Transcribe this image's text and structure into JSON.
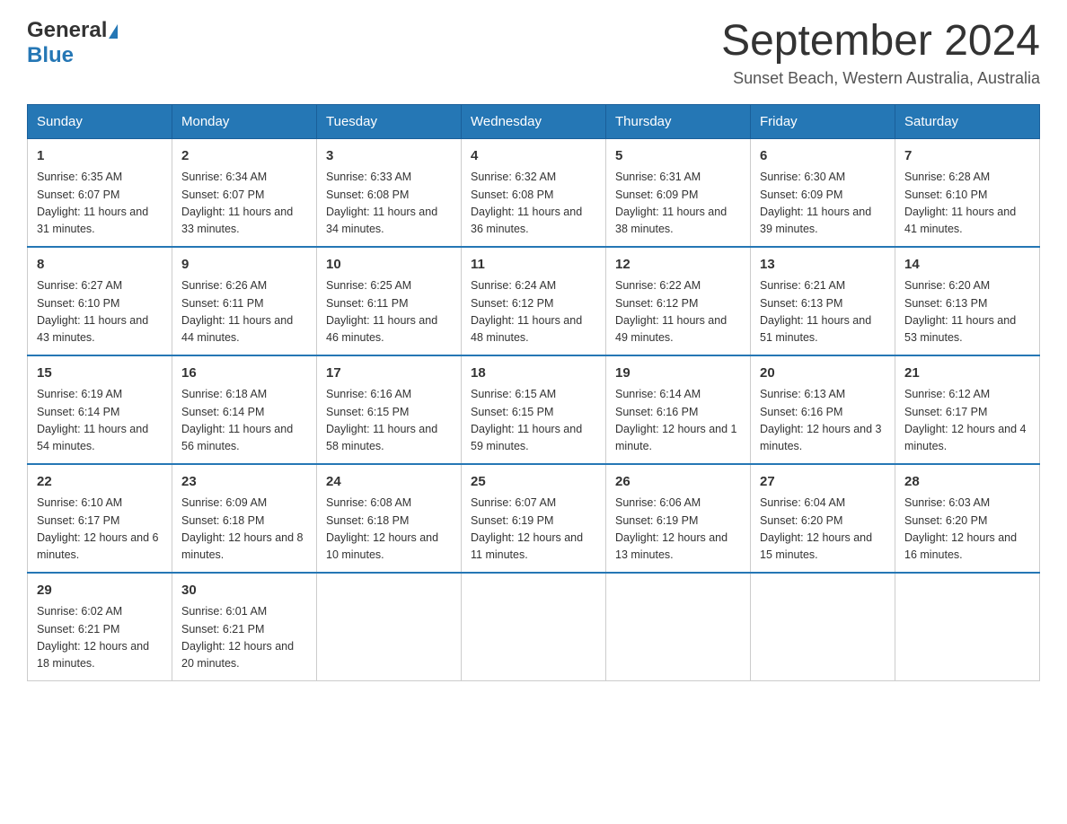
{
  "header": {
    "logo_general": "General",
    "logo_blue": "Blue",
    "month_year": "September 2024",
    "location": "Sunset Beach, Western Australia, Australia"
  },
  "days_of_week": [
    "Sunday",
    "Monday",
    "Tuesday",
    "Wednesday",
    "Thursday",
    "Friday",
    "Saturday"
  ],
  "weeks": [
    [
      {
        "day": "1",
        "sunrise": "6:35 AM",
        "sunset": "6:07 PM",
        "daylight": "11 hours and 31 minutes."
      },
      {
        "day": "2",
        "sunrise": "6:34 AM",
        "sunset": "6:07 PM",
        "daylight": "11 hours and 33 minutes."
      },
      {
        "day": "3",
        "sunrise": "6:33 AM",
        "sunset": "6:08 PM",
        "daylight": "11 hours and 34 minutes."
      },
      {
        "day": "4",
        "sunrise": "6:32 AM",
        "sunset": "6:08 PM",
        "daylight": "11 hours and 36 minutes."
      },
      {
        "day": "5",
        "sunrise": "6:31 AM",
        "sunset": "6:09 PM",
        "daylight": "11 hours and 38 minutes."
      },
      {
        "day": "6",
        "sunrise": "6:30 AM",
        "sunset": "6:09 PM",
        "daylight": "11 hours and 39 minutes."
      },
      {
        "day": "7",
        "sunrise": "6:28 AM",
        "sunset": "6:10 PM",
        "daylight": "11 hours and 41 minutes."
      }
    ],
    [
      {
        "day": "8",
        "sunrise": "6:27 AM",
        "sunset": "6:10 PM",
        "daylight": "11 hours and 43 minutes."
      },
      {
        "day": "9",
        "sunrise": "6:26 AM",
        "sunset": "6:11 PM",
        "daylight": "11 hours and 44 minutes."
      },
      {
        "day": "10",
        "sunrise": "6:25 AM",
        "sunset": "6:11 PM",
        "daylight": "11 hours and 46 minutes."
      },
      {
        "day": "11",
        "sunrise": "6:24 AM",
        "sunset": "6:12 PM",
        "daylight": "11 hours and 48 minutes."
      },
      {
        "day": "12",
        "sunrise": "6:22 AM",
        "sunset": "6:12 PM",
        "daylight": "11 hours and 49 minutes."
      },
      {
        "day": "13",
        "sunrise": "6:21 AM",
        "sunset": "6:13 PM",
        "daylight": "11 hours and 51 minutes."
      },
      {
        "day": "14",
        "sunrise": "6:20 AM",
        "sunset": "6:13 PM",
        "daylight": "11 hours and 53 minutes."
      }
    ],
    [
      {
        "day": "15",
        "sunrise": "6:19 AM",
        "sunset": "6:14 PM",
        "daylight": "11 hours and 54 minutes."
      },
      {
        "day": "16",
        "sunrise": "6:18 AM",
        "sunset": "6:14 PM",
        "daylight": "11 hours and 56 minutes."
      },
      {
        "day": "17",
        "sunrise": "6:16 AM",
        "sunset": "6:15 PM",
        "daylight": "11 hours and 58 minutes."
      },
      {
        "day": "18",
        "sunrise": "6:15 AM",
        "sunset": "6:15 PM",
        "daylight": "11 hours and 59 minutes."
      },
      {
        "day": "19",
        "sunrise": "6:14 AM",
        "sunset": "6:16 PM",
        "daylight": "12 hours and 1 minute."
      },
      {
        "day": "20",
        "sunrise": "6:13 AM",
        "sunset": "6:16 PM",
        "daylight": "12 hours and 3 minutes."
      },
      {
        "day": "21",
        "sunrise": "6:12 AM",
        "sunset": "6:17 PM",
        "daylight": "12 hours and 4 minutes."
      }
    ],
    [
      {
        "day": "22",
        "sunrise": "6:10 AM",
        "sunset": "6:17 PM",
        "daylight": "12 hours and 6 minutes."
      },
      {
        "day": "23",
        "sunrise": "6:09 AM",
        "sunset": "6:18 PM",
        "daylight": "12 hours and 8 minutes."
      },
      {
        "day": "24",
        "sunrise": "6:08 AM",
        "sunset": "6:18 PM",
        "daylight": "12 hours and 10 minutes."
      },
      {
        "day": "25",
        "sunrise": "6:07 AM",
        "sunset": "6:19 PM",
        "daylight": "12 hours and 11 minutes."
      },
      {
        "day": "26",
        "sunrise": "6:06 AM",
        "sunset": "6:19 PM",
        "daylight": "12 hours and 13 minutes."
      },
      {
        "day": "27",
        "sunrise": "6:04 AM",
        "sunset": "6:20 PM",
        "daylight": "12 hours and 15 minutes."
      },
      {
        "day": "28",
        "sunrise": "6:03 AM",
        "sunset": "6:20 PM",
        "daylight": "12 hours and 16 minutes."
      }
    ],
    [
      {
        "day": "29",
        "sunrise": "6:02 AM",
        "sunset": "6:21 PM",
        "daylight": "12 hours and 18 minutes."
      },
      {
        "day": "30",
        "sunrise": "6:01 AM",
        "sunset": "6:21 PM",
        "daylight": "12 hours and 20 minutes."
      },
      null,
      null,
      null,
      null,
      null
    ]
  ]
}
